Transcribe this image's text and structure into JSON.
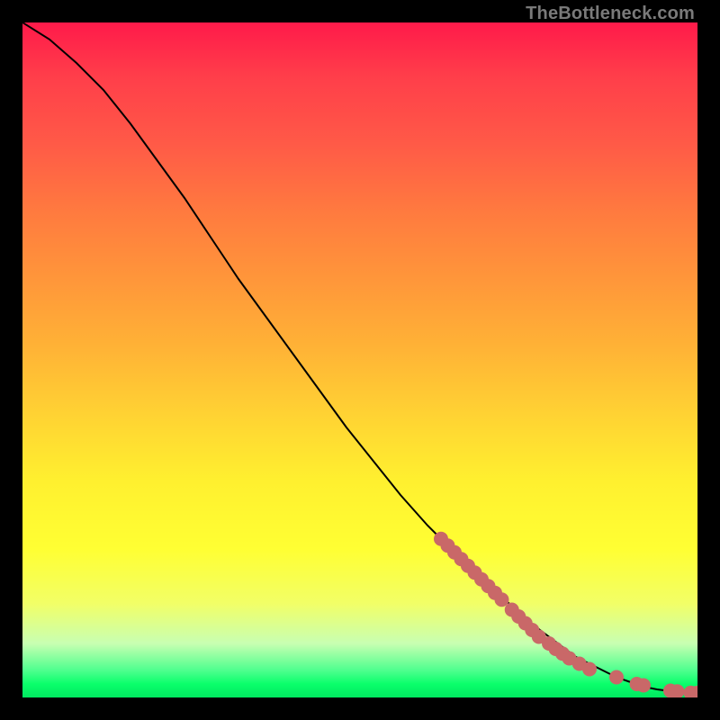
{
  "watermark": "TheBottleneck.com",
  "chart_data": {
    "type": "line",
    "title": "",
    "xlabel": "",
    "ylabel": "",
    "xlim": [
      0,
      100
    ],
    "ylim": [
      0,
      100
    ],
    "grid": false,
    "series": [
      {
        "name": "curve",
        "x": [
          0,
          4,
          8,
          12,
          16,
          20,
          24,
          28,
          32,
          36,
          40,
          44,
          48,
          52,
          56,
          60,
          62,
          64,
          66,
          68,
          70,
          72,
          74,
          76,
          78,
          80,
          82,
          84,
          86,
          88,
          90,
          92,
          93,
          94,
          95.5,
          97,
          98.5,
          100
        ],
        "y": [
          100,
          97.5,
          94,
          90,
          85,
          79.5,
          74,
          68,
          62,
          56.5,
          51,
          45.5,
          40,
          35,
          30,
          25.5,
          23.5,
          21.5,
          19.5,
          17.5,
          16,
          14,
          12,
          10.5,
          9,
          7.5,
          6,
          5,
          4,
          3,
          2.3,
          1.7,
          1.4,
          1.2,
          1.0,
          0.8,
          0.7,
          0.7
        ]
      },
      {
        "name": "markers",
        "x": [
          62,
          63,
          64,
          65,
          66,
          67,
          68,
          69,
          70,
          71,
          72.5,
          73.5,
          74.5,
          75.5,
          76.5,
          78,
          79,
          80,
          81,
          82.5,
          84,
          88,
          91,
          92,
          96,
          97,
          99,
          100
        ],
        "y": [
          23.5,
          22.5,
          21.5,
          20.5,
          19.5,
          18.5,
          17.5,
          16.5,
          15.5,
          14.5,
          13,
          12,
          11,
          10,
          9,
          8,
          7.2,
          6.5,
          5.8,
          5.0,
          4.2,
          3,
          2,
          1.8,
          1.0,
          0.9,
          0.7,
          0.7
        ]
      }
    ]
  },
  "colors": {
    "curve": "#000000",
    "marker": "#c96868",
    "gradient_top": "#ff1a4a",
    "gradient_bottom": "#00e860",
    "background": "#000000"
  }
}
